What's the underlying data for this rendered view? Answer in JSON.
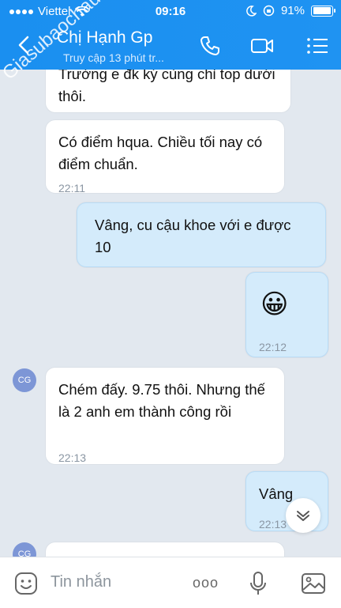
{
  "status": {
    "carrier": "Viettel",
    "time": "09:16",
    "battery": "91%"
  },
  "header": {
    "name": "Chị Hạnh Gp",
    "subtitle": "Truy cập 13 phút tr..."
  },
  "watermark": "Giasubaochau.net",
  "messages": [
    {
      "side": "left",
      "text": "Trường e đk ký cùng chỉ top dưới thôi.",
      "time": ""
    },
    {
      "side": "left",
      "text": "Có điểm hqua. Chiều tối nay có điểm chuẩn.",
      "time": "22:11"
    },
    {
      "side": "right",
      "text": "Vâng, cu cậu khoe với e được 10",
      "time": ""
    },
    {
      "side": "right",
      "text": "😀",
      "time": "22:12"
    },
    {
      "side": "left",
      "avatar": "CG",
      "text": "Chém đấy. 9.75 thôi. Nhưng thế là 2 anh em thành công rồi",
      "time": "22:13"
    },
    {
      "side": "right",
      "text": "Vâng",
      "time": "22:13"
    },
    {
      "side": "left",
      "avatar": "CG",
      "text": "",
      "time": ""
    }
  ],
  "input": {
    "placeholder": "Tin nhắn",
    "more_label": "ooo"
  },
  "colors": {
    "header_blue": "#1a8ff0",
    "my_bubble": "#d4ebfb",
    "chat_bg": "#e2e8ef"
  },
  "icons": [
    "back-arrow-icon",
    "phone-icon",
    "video-call-icon",
    "menu-list-icon",
    "emoji-icon",
    "more-icon",
    "microphone-icon",
    "image-icon",
    "chevron-down-icon",
    "wifi-icon",
    "moon-icon",
    "lock-rotation-icon"
  ]
}
